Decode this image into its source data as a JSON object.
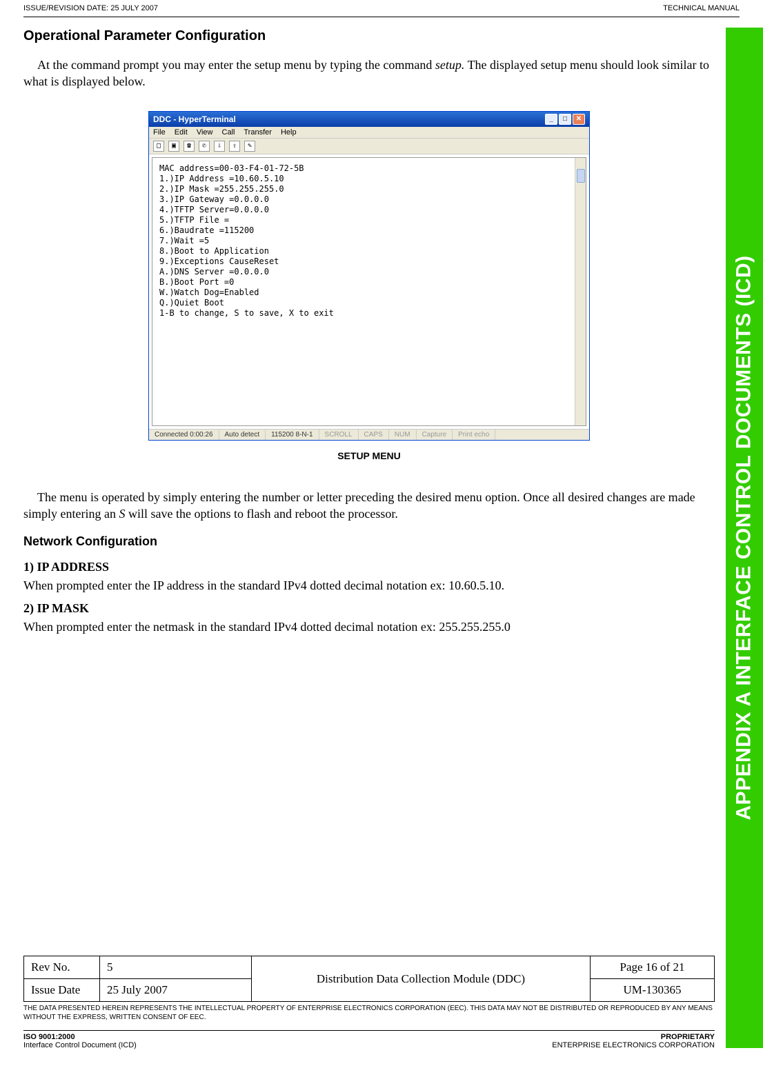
{
  "header": {
    "issue_date": "ISSUE/REVISION DATE:  25 JULY 2007",
    "manual": "TECHNICAL MANUAL"
  },
  "side_tab": "APPENDIX A  INTERFACE CONTROL DOCUMENTS (ICD)",
  "title": "Operational Parameter Configuration",
  "intro": "At the command prompt you may enter the setup menu by typing the command setup. The displayed setup menu should look similar to what is displayed below.",
  "ht": {
    "title": "DDC - HyperTerminal",
    "menu": [
      "File",
      "Edit",
      "View",
      "Call",
      "Transfer",
      "Help"
    ],
    "terminal_lines": [
      "MAC address=00-03-F4-01-72-5B",
      "1.)IP Address =10.60.5.10",
      "2.)IP Mask    =255.255.255.0",
      "3.)IP Gateway =0.0.0.0",
      "4.)TFTP Server=0.0.0.0",
      "5.)TFTP File  =",
      "6.)Baudrate  =115200",
      "7.)Wait      =5",
      "8.)Boot to Application",
      "9.)Exceptions CauseReset",
      "A.)DNS Server =0.0.0.0",
      "B.)Boot Port =0",
      "W.)Watch Dog=Enabled",
      "Q.)Quiet Boot",
      "1-B to change, S to save, X to exit"
    ],
    "status": {
      "connected": "Connected 0:00:26",
      "detect": "Auto detect",
      "settings": "115200 8-N-1",
      "scroll": "SCROLL",
      "caps": "CAPS",
      "num": "NUM",
      "capture": "Capture",
      "printecho": "Print echo"
    }
  },
  "caption": "SETUP MENU",
  "menu_desc": "The menu is operated by simply entering the number or letter preceding the desired menu option. Once all desired changes are made simply entering an S will save the options to flash and reboot the processor.",
  "net_conf": "Network Configuration",
  "ip_addr_h": "1) IP ADDRESS",
  "ip_addr_p": "When prompted enter the IP address in the standard IPv4 dotted decimal notation ex: 10.60.5.10.",
  "ip_mask_h": "2) IP MASK",
  "ip_mask_p": "When prompted enter the netmask in the standard IPv4 dotted decimal notation ex: 255.255.255.0",
  "table": {
    "revno_l": "Rev No.",
    "revno_v": "5",
    "center": "Distribution Data Collection Module (DDC)",
    "page": "Page 16 of 21",
    "issue_l": "Issue Date",
    "issue_v": "25 July 2007",
    "um": "UM-130365"
  },
  "legal": "THE DATA PRESENTED HEREIN REPRESENTS THE INTELLECTUAL PROPERTY OF ENTERPRISE ELECTRONICS CORPORATION (EEC).  THIS DATA MAY NOT BE DISTRIBUTED OR REPRODUCED BY ANY MEANS WITHOUT THE EXPRESS, WRITTEN CONSENT OF EEC.",
  "footer": {
    "iso": "ISO 9001:2000",
    "icd": "Interface Control Document (ICD)",
    "prop": "PROPRIETARY",
    "corp": "ENTERPRISE ELECTRONICS CORPORATION"
  }
}
